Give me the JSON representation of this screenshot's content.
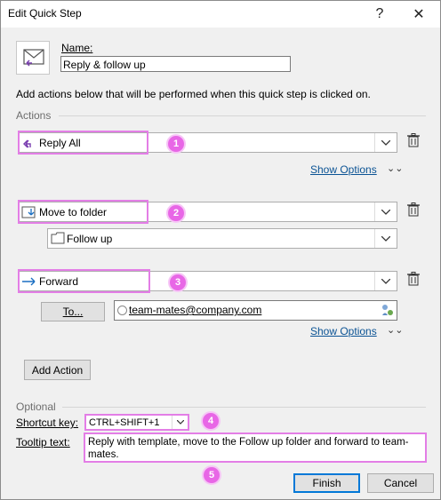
{
  "window": {
    "title": "Edit Quick Step",
    "help_label": "?",
    "close_label": "✕"
  },
  "name": {
    "label": "Name:",
    "value": "Reply & follow up"
  },
  "description": "Add actions below that will be performed when this quick step is clicked on.",
  "actions_label": "Actions",
  "actions": [
    {
      "label": "Reply All",
      "badge": "1",
      "show_options": "Show Options"
    },
    {
      "label": "Move to folder",
      "badge": "2",
      "folder": "Follow up"
    },
    {
      "label": "Forward",
      "badge": "3",
      "to_label": "To...",
      "recipient": "team-mates@company.com",
      "show_options": "Show Options"
    }
  ],
  "add_action_label": "Add Action",
  "optional_label": "Optional",
  "shortcut": {
    "label": "Shortcut key:",
    "value": "CTRL+SHIFT+1",
    "badge": "4"
  },
  "tooltip": {
    "label": "Tooltip text:",
    "value": "Reply with template, move to the Follow up folder and forward to team-mates.",
    "badge": "5"
  },
  "buttons": {
    "finish": "Finish",
    "cancel": "Cancel"
  },
  "colors": {
    "highlight": "#e37ee6",
    "badge": "#e867e6",
    "link": "#0b5394",
    "primary_border": "#0078d7"
  }
}
